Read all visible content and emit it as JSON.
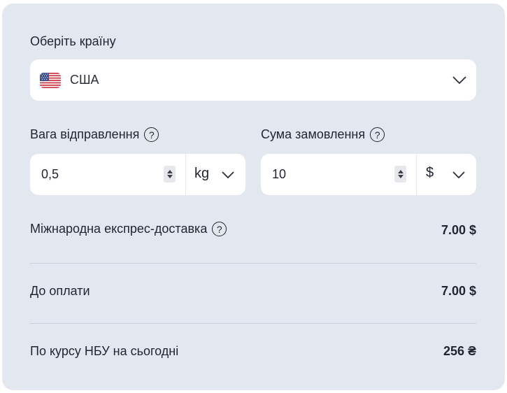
{
  "country_section": {
    "label": "Оберіть країну",
    "selected": "США",
    "flag_icon": "us-flag-icon"
  },
  "weight": {
    "label": "Вага відправлення",
    "help": "?",
    "value": "0,5",
    "unit": "kg"
  },
  "order_sum": {
    "label": "Сума замовлення",
    "help": "?",
    "value": "10",
    "currency": "$"
  },
  "rows": [
    {
      "label": "Міжнародна експрес-доставка",
      "has_help": true,
      "help": "?",
      "value": "7.00 $"
    },
    {
      "label": "До оплати",
      "value": "7.00 $"
    },
    {
      "label": "По курсу НБУ на сьогодні",
      "value": "256 ₴"
    }
  ],
  "colors": {
    "card_background": "#e3e8f0",
    "field_background": "#ffffff",
    "text": "#1f2430"
  }
}
